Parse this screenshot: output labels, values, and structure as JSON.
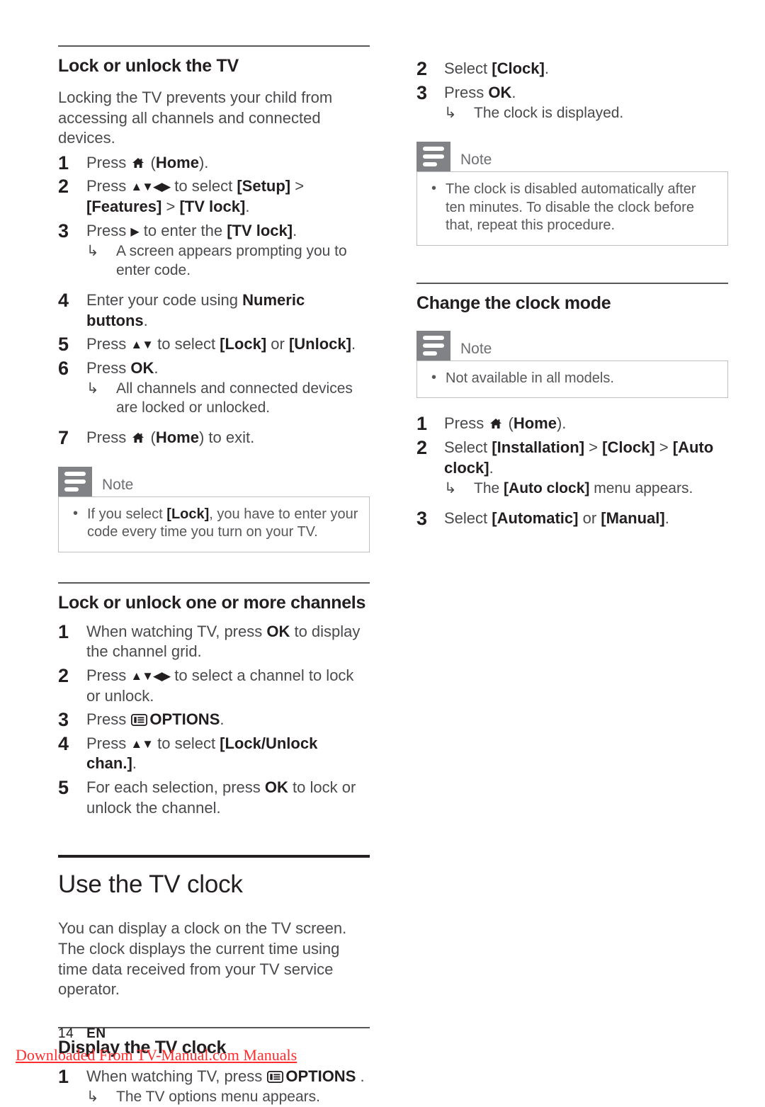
{
  "page": {
    "number": "14",
    "language": "EN",
    "watermark": "Downloaded From TV-Manual.com Manuals"
  },
  "icons": {
    "home": "home-icon",
    "options": "options-icon",
    "note": "note-icon",
    "nav_all": "▲▼◀▶",
    "nav_updown": "▲▼",
    "nav_right": "▶",
    "hook": "↳"
  },
  "left_column": {
    "section_lock_tv": {
      "heading": "Lock or unlock the TV",
      "intro": "Locking the TV prevents your child from accessing all channels and connected devices.",
      "steps": [
        {
          "num": "1",
          "pre": "Press ",
          "icon": "home",
          "post_a": " (",
          "bold_a": "Home",
          "post_b": ")."
        },
        {
          "num": "2",
          "pre": "Press ",
          "icon": "nav_all",
          "mid": " to select ",
          "bold_a": "[Setup]",
          "mid2": " > ",
          "bold_b": "[Features]",
          "mid3": " > ",
          "bold_c": "[TV lock]",
          "post": "."
        },
        {
          "num": "3",
          "pre": "Press ",
          "icon": "nav_right",
          "mid": " to enter the ",
          "bold_a": "[TV lock]",
          "post": ".",
          "result": "A screen appears prompting you to enter code."
        },
        {
          "num": "4",
          "pre": "Enter your code using ",
          "bold_a": "Numeric buttons",
          "post": "."
        },
        {
          "num": "5",
          "pre": "Press ",
          "icon": "nav_updown",
          "mid": " to select ",
          "bold_a": "[Lock]",
          "mid2": " or ",
          "bold_b": "[Unlock]",
          "post": "."
        },
        {
          "num": "6",
          "pre": "Press ",
          "bold_a": "OK",
          "post": ".",
          "result": "All channels and connected devices are locked or unlocked."
        },
        {
          "num": "7",
          "pre": "Press ",
          "icon": "home",
          "post_a": " (",
          "bold_a": "Home",
          "post_b": ") to exit."
        }
      ],
      "note": {
        "title": "Note",
        "items": [
          {
            "pre": "If you select ",
            "bold_a": "[Lock]",
            "post": ", you have to enter your code every time you turn on your TV."
          }
        ]
      }
    },
    "section_lock_channels": {
      "heading": "Lock or unlock one or more channels",
      "steps": [
        {
          "num": "1",
          "pre": "When watching TV, press ",
          "bold_a": "OK",
          "post": " to display the channel grid."
        },
        {
          "num": "2",
          "pre": "Press ",
          "icon": "nav_all",
          "mid": " to select a channel to lock or unlock."
        },
        {
          "num": "3",
          "pre": "Press ",
          "icon": "options",
          "bold_a": "OPTIONS",
          "post": "."
        },
        {
          "num": "4",
          "pre": "Press ",
          "icon": "nav_updown",
          "mid": " to select ",
          "bold_a": "[Lock/Unlock chan.]",
          "post": "."
        },
        {
          "num": "5",
          "pre": "For each selection, press ",
          "bold_a": "OK",
          "post": " to lock or unlock the channel."
        }
      ]
    },
    "section_tv_clock": {
      "heading": "Use the TV clock",
      "intro": "You can display a clock on the TV screen. The clock displays the current time using time data received from your TV service operator."
    },
    "section_display_clock": {
      "heading": "Display the TV clock",
      "steps": [
        {
          "num": "1",
          "pre": "When watching TV, press ",
          "icon": "options",
          "bold_a": "OPTIONS",
          "post": " .",
          "result": "The TV options menu appears."
        }
      ]
    }
  },
  "right_column": {
    "section_display_clock_cont": {
      "steps": [
        {
          "num": "2",
          "pre": "Select ",
          "bold_a": "[Clock]",
          "post": "."
        },
        {
          "num": "3",
          "pre": "Press ",
          "bold_a": "OK",
          "post": ".",
          "result": "The clock is displayed."
        }
      ],
      "note": {
        "title": "Note",
        "items": [
          {
            "pre": "The clock is disabled automatically after ten minutes. To disable the clock before that, repeat this procedure."
          }
        ]
      }
    },
    "section_clock_mode": {
      "heading": "Change the clock mode",
      "note": {
        "title": "Note",
        "items": [
          {
            "pre": "Not available in all models."
          }
        ]
      },
      "steps": [
        {
          "num": "1",
          "pre": "Press ",
          "icon": "home",
          "post_a": " (",
          "bold_a": "Home",
          "post_b": ")."
        },
        {
          "num": "2",
          "pre": "Select ",
          "bold_a": "[Installation]",
          "mid2": " > ",
          "bold_b": "[Clock]",
          "mid3": " > ",
          "bold_c": "[Auto clock]",
          "post": ".",
          "result_pre": "The ",
          "result_bold": "[Auto clock]",
          "result_post": " menu appears."
        },
        {
          "num": "3",
          "pre": "Select ",
          "bold_a": "[Automatic]",
          "mid2": " or ",
          "bold_b": "[Manual]",
          "post": "."
        }
      ]
    }
  },
  "colors": {
    "heading": "#231f20",
    "body": "#4a4a4d",
    "note_icon_bg": "#808285",
    "note_border": "#bcbec0",
    "watermark": "#ff2d2d"
  }
}
